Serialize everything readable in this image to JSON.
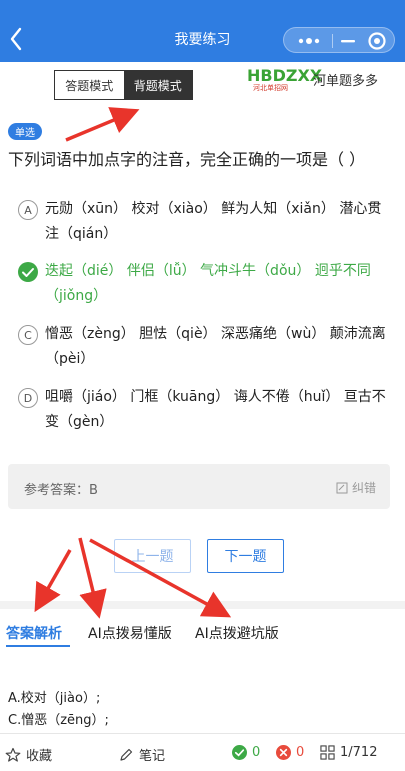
{
  "header": {
    "title": "我要练习"
  },
  "mode": {
    "answer_label": "答题模式",
    "recite_label": "背题模式"
  },
  "brand": {
    "logo_text": "HBDZXX",
    "logo_sub": "河北单招网",
    "name": "河单题多多"
  },
  "question": {
    "type": "单选",
    "text": "下列词语中加点字的注音，完全正确的一项是（  ）",
    "options": [
      {
        "marker": "A",
        "text": "元勋（xūn） 校对（xiào） 鲜为人知（xiǎn） 潜心贯注（qián）",
        "correct": false
      },
      {
        "marker": "B",
        "text": "迭起（dié） 伴侣（lǚ） 气冲斗牛（dǒu） 迥乎不同（jiǒng）",
        "correct": true
      },
      {
        "marker": "C",
        "text": "憎恶（zèng） 胆怯（qiè） 深恶痛绝（wù） 颠沛流离（pèi）",
        "correct": false
      },
      {
        "marker": "D",
        "text": "咀嚼（jiáo） 门框（kuāng） 诲人不倦（huǐ） 亘古不变（gèn）",
        "correct": false
      }
    ]
  },
  "reference": {
    "label": "参考答案：B",
    "fix_label": "纠错"
  },
  "nav": {
    "prev_label": "上一题",
    "next_label": "下一题"
  },
  "tabs": [
    {
      "label": "答案解析",
      "active": true
    },
    {
      "label": "AI点拨易懂版",
      "active": false
    },
    {
      "label": "AI点拨避坑版",
      "active": false
    }
  ],
  "analysis": {
    "line1": "A.校对（jiào）;",
    "line2": "C.憎恶（zēng）;"
  },
  "bottom": {
    "favorite_label": "收藏",
    "notes_label": "笔记",
    "correct_count": "0",
    "wrong_count": "0",
    "progress": "1/712"
  },
  "colors": {
    "primary": "#2f7de1",
    "correct": "#3da946",
    "wrong": "#e84b3c",
    "annotation": "#e8342b"
  }
}
